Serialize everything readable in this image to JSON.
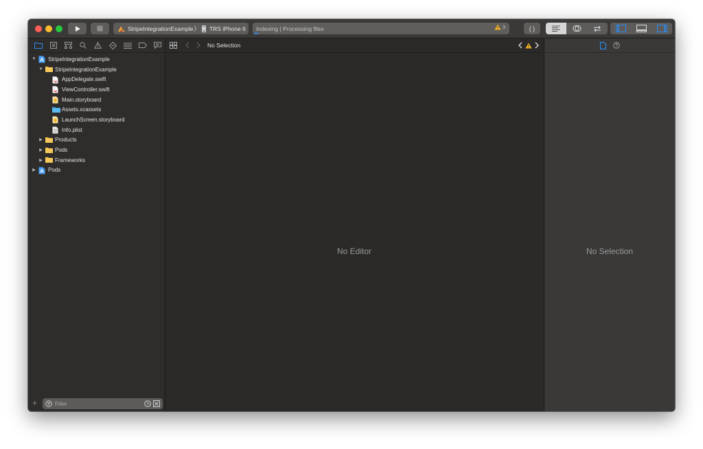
{
  "toolbar": {
    "run_icon": "play-icon",
    "stop_icon": "stop-icon",
    "scheme": "StripeIntegrationExample",
    "scheme_separator": "〉",
    "device": "TRS iPhone 6",
    "activity_status": "Indexing | Processing files",
    "warning_count": "3",
    "library_button": "{ }",
    "editor_modes": [
      "standard-editor-icon",
      "assistant-editor-icon",
      "version-editor-icon"
    ],
    "panel_toggles": [
      "navigator-toggle-icon",
      "debug-area-toggle-icon",
      "inspector-toggle-icon"
    ]
  },
  "navigator": {
    "tabs": [
      "project-navigator",
      "source-control-navigator",
      "symbol-navigator",
      "find-navigator",
      "issue-navigator",
      "test-navigator",
      "debug-navigator",
      "breakpoint-navigator",
      "report-navigator"
    ],
    "tree": [
      {
        "label": "StripeIntegrationExample",
        "type": "project",
        "depth": 0,
        "disclosure": "open"
      },
      {
        "label": "StripeIntegrationExample",
        "type": "folder",
        "depth": 1,
        "disclosure": "open"
      },
      {
        "label": "AppDelegate.swift",
        "type": "swift",
        "depth": 2,
        "disclosure": "none"
      },
      {
        "label": "ViewController.swift",
        "type": "swift",
        "depth": 2,
        "disclosure": "none"
      },
      {
        "label": "Main.storyboard",
        "type": "storyboard",
        "depth": 2,
        "disclosure": "none"
      },
      {
        "label": "Assets.xcassets",
        "type": "assets",
        "depth": 2,
        "disclosure": "none"
      },
      {
        "label": "LaunchScreen.storyboard",
        "type": "storyboard",
        "depth": 2,
        "disclosure": "none"
      },
      {
        "label": "Info.plist",
        "type": "plist",
        "depth": 2,
        "disclosure": "none"
      },
      {
        "label": "Products",
        "type": "folder",
        "depth": 1,
        "disclosure": "closed"
      },
      {
        "label": "Pods",
        "type": "folder",
        "depth": 1,
        "disclosure": "closed"
      },
      {
        "label": "Frameworks",
        "type": "folder",
        "depth": 1,
        "disclosure": "closed"
      },
      {
        "label": "Pods",
        "type": "project",
        "depth": 0,
        "disclosure": "closed"
      }
    ],
    "filter_placeholder": "Filter"
  },
  "editor": {
    "jump_bar_selection": "No Selection",
    "placeholder": "No Editor"
  },
  "inspector": {
    "tabs": [
      "file-inspector",
      "quick-help-inspector"
    ],
    "placeholder": "No Selection"
  },
  "colors": {
    "accent": "#2a8cf1",
    "warning": "#f5b823",
    "folder": "#f2c14e"
  }
}
